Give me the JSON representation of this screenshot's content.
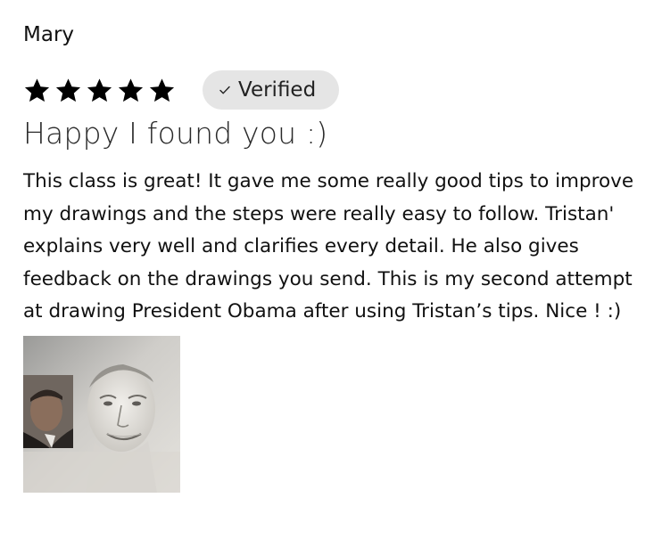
{
  "review": {
    "author": "Mary",
    "rating": 5,
    "max_rating": 5,
    "star_color": "#000000",
    "badge": {
      "label": "Verified",
      "icon": "checkmark-icon",
      "background": "#e5e5e5"
    },
    "title": "Happy I found you :)",
    "body": "This class is great! It gave me some really good tips to improve my drawings and the steps were really easy to follow. Tristan' explains very well and clarifies every detail. He also gives feedback on the drawings you send. This is my second attempt at drawing President Obama after using Tristan’s tips. Nice ! :)",
    "attachment": {
      "type": "photo"
    }
  }
}
